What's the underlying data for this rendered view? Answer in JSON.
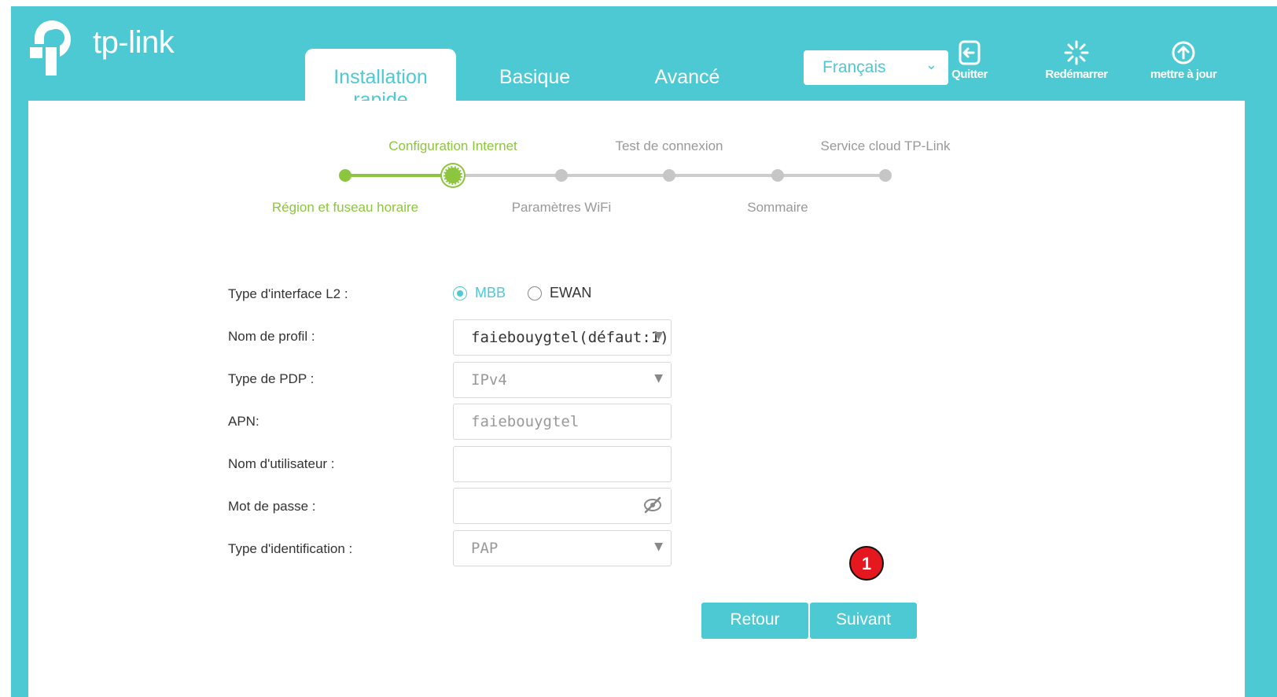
{
  "brand": {
    "name": "tp-link"
  },
  "nav": {
    "tabs": [
      {
        "label": "Installation rapide",
        "active": true
      },
      {
        "label": "Basique",
        "active": false
      },
      {
        "label": "Avancé",
        "active": false
      }
    ],
    "language": {
      "selected": "Français"
    },
    "actions": [
      {
        "label": "Quitter",
        "icon": "logout-icon"
      },
      {
        "label": "Redémarrer",
        "icon": "restart-icon"
      },
      {
        "label": "mettre à jour",
        "icon": "upgrade-icon"
      }
    ]
  },
  "progress": {
    "top_labels": [
      "Configuration Internet",
      "Test de connexion",
      "Service cloud TP-Link"
    ],
    "bottom_labels": [
      "Région et fuseau horaire",
      "Paramètres WiFi",
      "Sommaire"
    ],
    "current_step": 2,
    "total_steps": 6
  },
  "form": {
    "l2_type": {
      "label": "Type d'interface L2 :",
      "options": [
        "MBB",
        "EWAN"
      ],
      "selected": "MBB"
    },
    "profile_name": {
      "label": "Nom de profil :",
      "value": "faiebouygtel(défaut:1)"
    },
    "pdp_type": {
      "label": "Type de PDP :",
      "value": "IPv4"
    },
    "apn": {
      "label": "APN:",
      "value": "faiebouygtel"
    },
    "username": {
      "label": "Nom d'utilisateur :",
      "value": ""
    },
    "password": {
      "label": "Mot de passe :",
      "value": ""
    },
    "auth_type": {
      "label": "Type d'identification :",
      "value": "PAP"
    }
  },
  "buttons": {
    "back": "Retour",
    "next": "Suivant"
  },
  "annotation": {
    "marker": "1"
  },
  "colors": {
    "accent": "#4dc9d4",
    "progress_done": "#8cc63f",
    "marker": "#e4181e"
  }
}
